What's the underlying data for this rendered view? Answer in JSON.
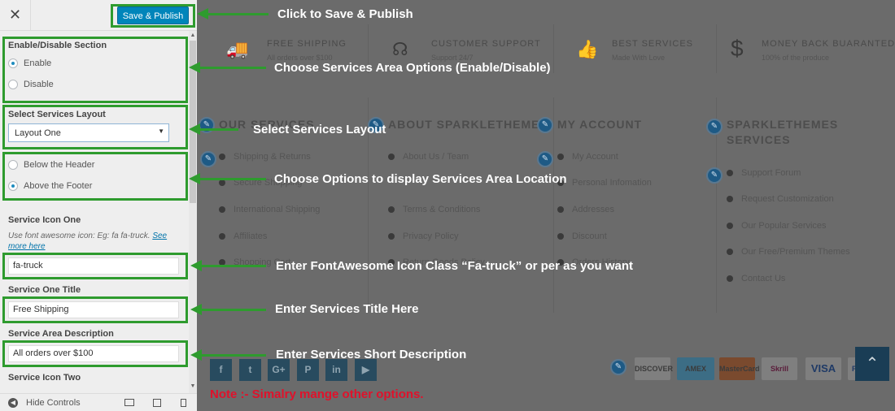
{
  "panel": {
    "close_glyph": "✕",
    "save_publish": "Save & Publish",
    "enable_section": {
      "label": "Enable/Disable Section",
      "options": [
        "Enable",
        "Disable"
      ],
      "selected": "Enable"
    },
    "layout": {
      "label": "Select Services Layout",
      "value": "Layout One"
    },
    "location": {
      "options": [
        "Below the Header",
        "Above the Footer"
      ],
      "selected": "Above the Footer"
    },
    "service_icon_one": {
      "label": "Service Icon One",
      "help": "Use font awesome icon: Eg: fa fa-truck.",
      "help_link": "See more here",
      "value": "fa-truck"
    },
    "service_one_title": {
      "label": "Service One Title",
      "value": "Free Shipping"
    },
    "service_area_description": {
      "label": "Service Area Description",
      "value": "All orders over $100"
    },
    "service_icon_two": {
      "label": "Service Icon Two"
    },
    "footer": {
      "hide_controls": "Hide Controls"
    }
  },
  "preview": {
    "features": [
      {
        "icon": "truck-icon",
        "glyph": "🚚",
        "title": "FREE SHIPPING",
        "sub": "All orders over $100"
      },
      {
        "icon": "headset-icon",
        "glyph": "☊",
        "title": "CUSTOMER SUPPORT",
        "sub": "Support 24/7"
      },
      {
        "icon": "thumbs-up-icon",
        "glyph": "👍",
        "title": "BEST SERVICES",
        "sub": "Made With Love"
      },
      {
        "icon": "dollar-icon",
        "glyph": "$",
        "title": "MONEY BACK BUARANTED",
        "sub": "100% of the produce"
      }
    ],
    "columns": [
      {
        "title": "OUR SERVICES",
        "links": [
          "Shipping & Returns",
          "Secure Shopping",
          "International Shipping",
          "Affiliates",
          "Shopping Cart"
        ]
      },
      {
        "title": "ABOUT SPARKLETHEMES",
        "links": [
          "About Us / Team",
          "",
          "Terms & Conditions",
          "Privacy Policy",
          "Return Goods Policy"
        ]
      },
      {
        "title": "MY ACCOUNT",
        "links": [
          "My Account",
          "Personal Infomation",
          "Addresses",
          "Discount",
          "Orders History"
        ]
      },
      {
        "title_line1": "SPARKLETHEMES",
        "title_line2": "SERVICES",
        "links": [
          "Support Forum",
          "Request Customization",
          "Our Popular Services",
          "Our Free/Premium Themes",
          "Contact Us"
        ]
      }
    ],
    "social": [
      "f",
      "t",
      "G+",
      "P",
      "in",
      "▶"
    ],
    "payments": [
      "DISCOVER",
      "AMEX",
      "MasterCard",
      "Skrill",
      "VISA",
      "P"
    ],
    "to_top": "⌃"
  },
  "annotations": {
    "save": "Click to Save & Publish",
    "enable": "Choose Services Area Options (Enable/Disable)",
    "layout": "Select Services Layout",
    "location": "Choose Options to display Services Area Location",
    "icon": "Enter FontAwesome Icon Class “Fa-truck” or per as you want",
    "title": "Enter Services Title Here",
    "description": "Enter Services Short Description",
    "note": "Note :- Simalry mange other options."
  },
  "colors": {
    "highlight_green": "#2e9b2e",
    "save_button": "#0085ba",
    "note_red": "#e0112b"
  }
}
